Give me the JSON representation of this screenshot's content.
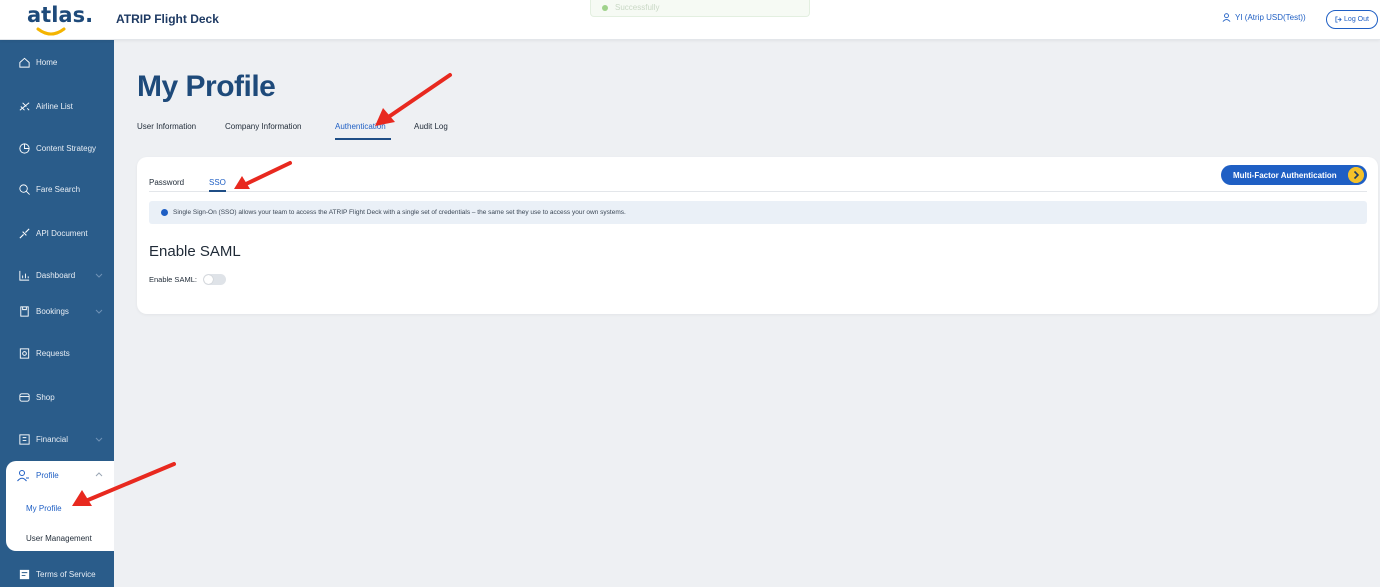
{
  "header": {
    "logo_text": "atlas.",
    "app_title": "ATRIP Flight Deck",
    "toast_text": "Successfully",
    "user_label": "YI (Atrip USD(Test))",
    "logout_label": "Log Out"
  },
  "sidebar": {
    "items": [
      {
        "label": "Home",
        "icon": "home-icon"
      },
      {
        "label": "Airline List",
        "icon": "airline-icon"
      },
      {
        "label": "Content Strategy",
        "icon": "strategy-icon"
      },
      {
        "label": "Fare Search",
        "icon": "search-icon"
      },
      {
        "label": "API Document",
        "icon": "api-icon"
      },
      {
        "label": "Dashboard",
        "icon": "chart-icon"
      },
      {
        "label": "Bookings",
        "icon": "bookings-icon"
      },
      {
        "label": "Requests",
        "icon": "requests-icon"
      },
      {
        "label": "Shop",
        "icon": "shop-icon"
      },
      {
        "label": "Financial",
        "icon": "financial-icon"
      }
    ],
    "profile": {
      "label": "Profile",
      "sub_items": [
        {
          "label": "My Profile",
          "active": true
        },
        {
          "label": "User Management",
          "active": false
        }
      ]
    },
    "footer_item": {
      "label": "Terms of Service"
    }
  },
  "main": {
    "page_title": "My Profile",
    "tabs": [
      {
        "label": "User Information"
      },
      {
        "label": "Company Information"
      },
      {
        "label": "Authentication",
        "active": true
      },
      {
        "label": "Audit Log"
      }
    ],
    "card": {
      "subtabs": [
        {
          "label": "Password"
        },
        {
          "label": "SSO",
          "active": true
        }
      ],
      "mfa_button": "Multi-Factor Authentication",
      "info_text": "Single Sign-On (SSO) allows your team to access the ATRIP Flight Deck with a single set of credentials – the same set they use to access your own systems.",
      "section_title": "Enable SAML",
      "saml_label": "Enable SAML:",
      "saml_enabled": false
    }
  },
  "colors": {
    "sidebar_bg": "#2a5c8a",
    "accent": "#1f5fc4",
    "title": "#1e4a7a",
    "annotation_arrow": "#e8291f",
    "mfa_arrow": "#f4c12a"
  }
}
